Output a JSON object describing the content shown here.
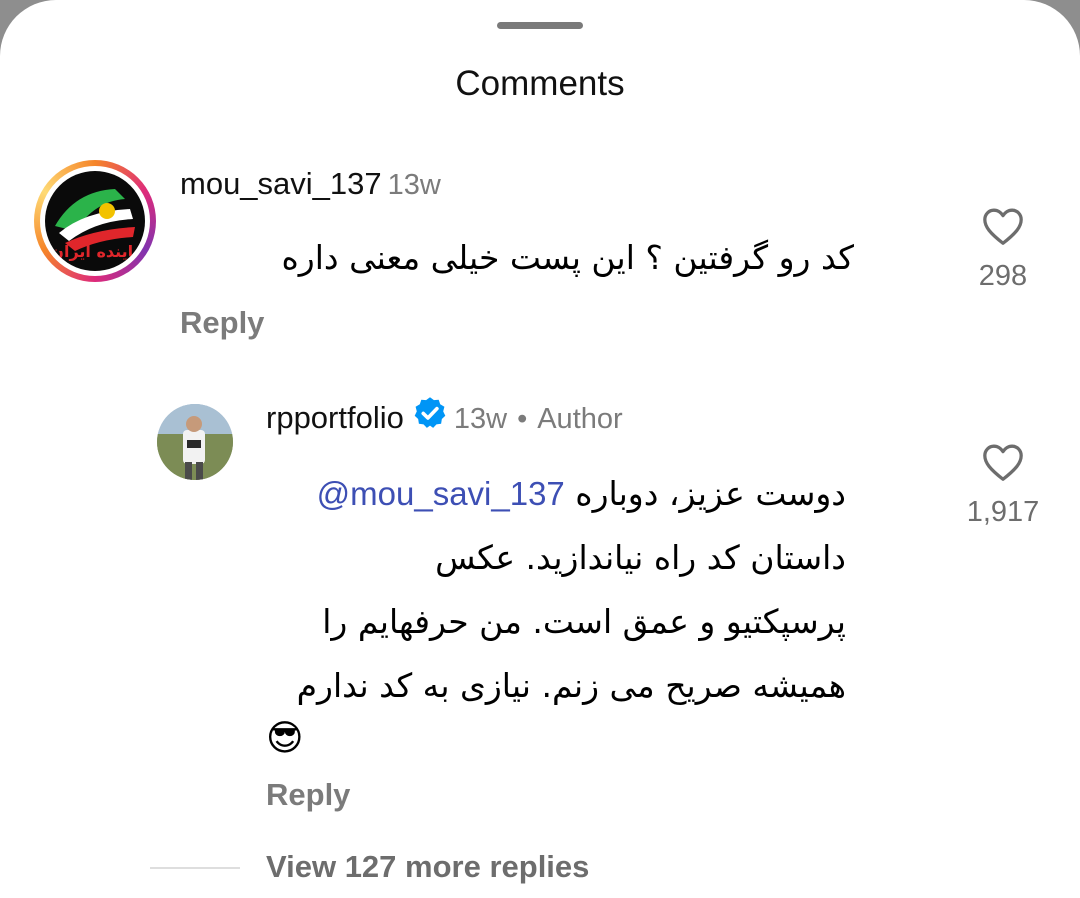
{
  "sheet": {
    "title": "Comments"
  },
  "comments": [
    {
      "username": "mou_savi_137",
      "time": "13w",
      "text": "کد رو گرفتین ؟ این پست خیلی معنی داره",
      "reply_label": "Reply",
      "likes": "298",
      "avatar_caption": "پاینده ایران"
    },
    {
      "username": "rpportfolio",
      "time": "13w",
      "separator": "•",
      "author_label": "Author",
      "mention": "@mou_savi_137",
      "text_lines": [
        "دوست عزیز، دوباره",
        "داستان کد راه نیاندازید. عکس",
        "پرسپکتیو و عمق است. من حرفهایم را",
        "همیشه صریح می زنم. نیازی به کد ندارم"
      ],
      "emoji": "😎",
      "reply_label": "Reply",
      "likes": "1,917"
    }
  ],
  "view_more": "View 127 more replies",
  "icons": {
    "heart": "heart-icon",
    "verified": "verified-badge-icon"
  },
  "colors": {
    "mention": "#3d4fb4",
    "verified": "#0095f6",
    "muted": "#7b7b7b"
  }
}
